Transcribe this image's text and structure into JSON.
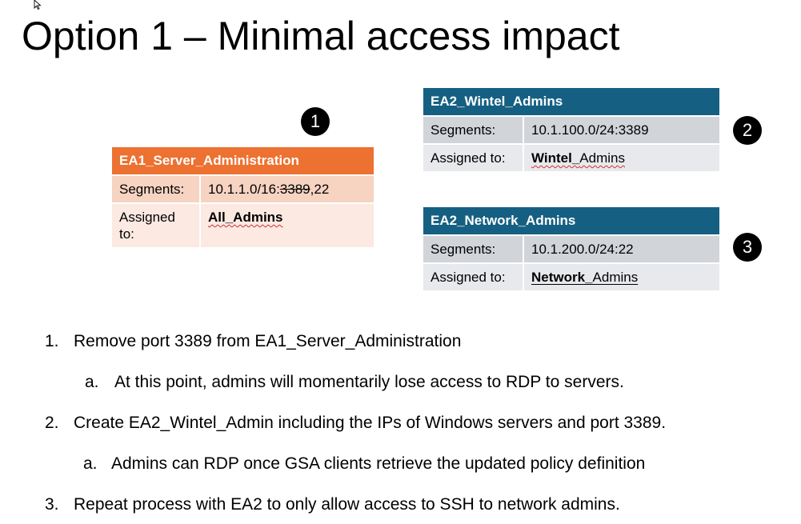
{
  "slide": {
    "title": "Option 1 – Minimal access impact"
  },
  "ea1": {
    "header": "EA1_Server_Administration",
    "segments_label": "Segments:",
    "segments_prefix": "10.1.1.0/16:",
    "segments_struck": "3389",
    "segments_suffix": ",22",
    "assigned_label": "Assigned to:",
    "assigned_value": "All_Admins"
  },
  "ea2_wintel": {
    "header": "EA2_Wintel_Admins",
    "segments_label": "Segments:",
    "segments_value": "10.1.100.0/24:3389",
    "assigned_label": "Assigned to:",
    "assigned_bold": "Wintel_",
    "assigned_rest": "Admins"
  },
  "ea2_network": {
    "header": "EA2_Network_Admins",
    "segments_label": "Segments:",
    "segments_value": "10.1.200.0/24:22",
    "assigned_label": "Assigned to:",
    "assigned_bold": "Network_",
    "assigned_rest": "Admins"
  },
  "badges": [
    "1",
    "2",
    "3"
  ],
  "steps": [
    {
      "num": "1.",
      "text": "Remove port 3389 from EA1_Server_Administration"
    },
    {
      "num": "a.",
      "text": "At this point, admins will momentarily lose access to RDP to servers."
    },
    {
      "num": "2.",
      "text": "Create EA2_Wintel_Admin including the IPs of Windows servers and port 3389."
    },
    {
      "num": "a.",
      "text": "Admins can RDP once GSA clients retrieve the updated policy definition"
    },
    {
      "num": "3.",
      "text": "Repeat process with EA2 to only allow access to SSH to network admins."
    }
  ],
  "colors": {
    "ea1_header": "#ed7131",
    "ea2_header": "#156082",
    "badge": "#000000"
  }
}
